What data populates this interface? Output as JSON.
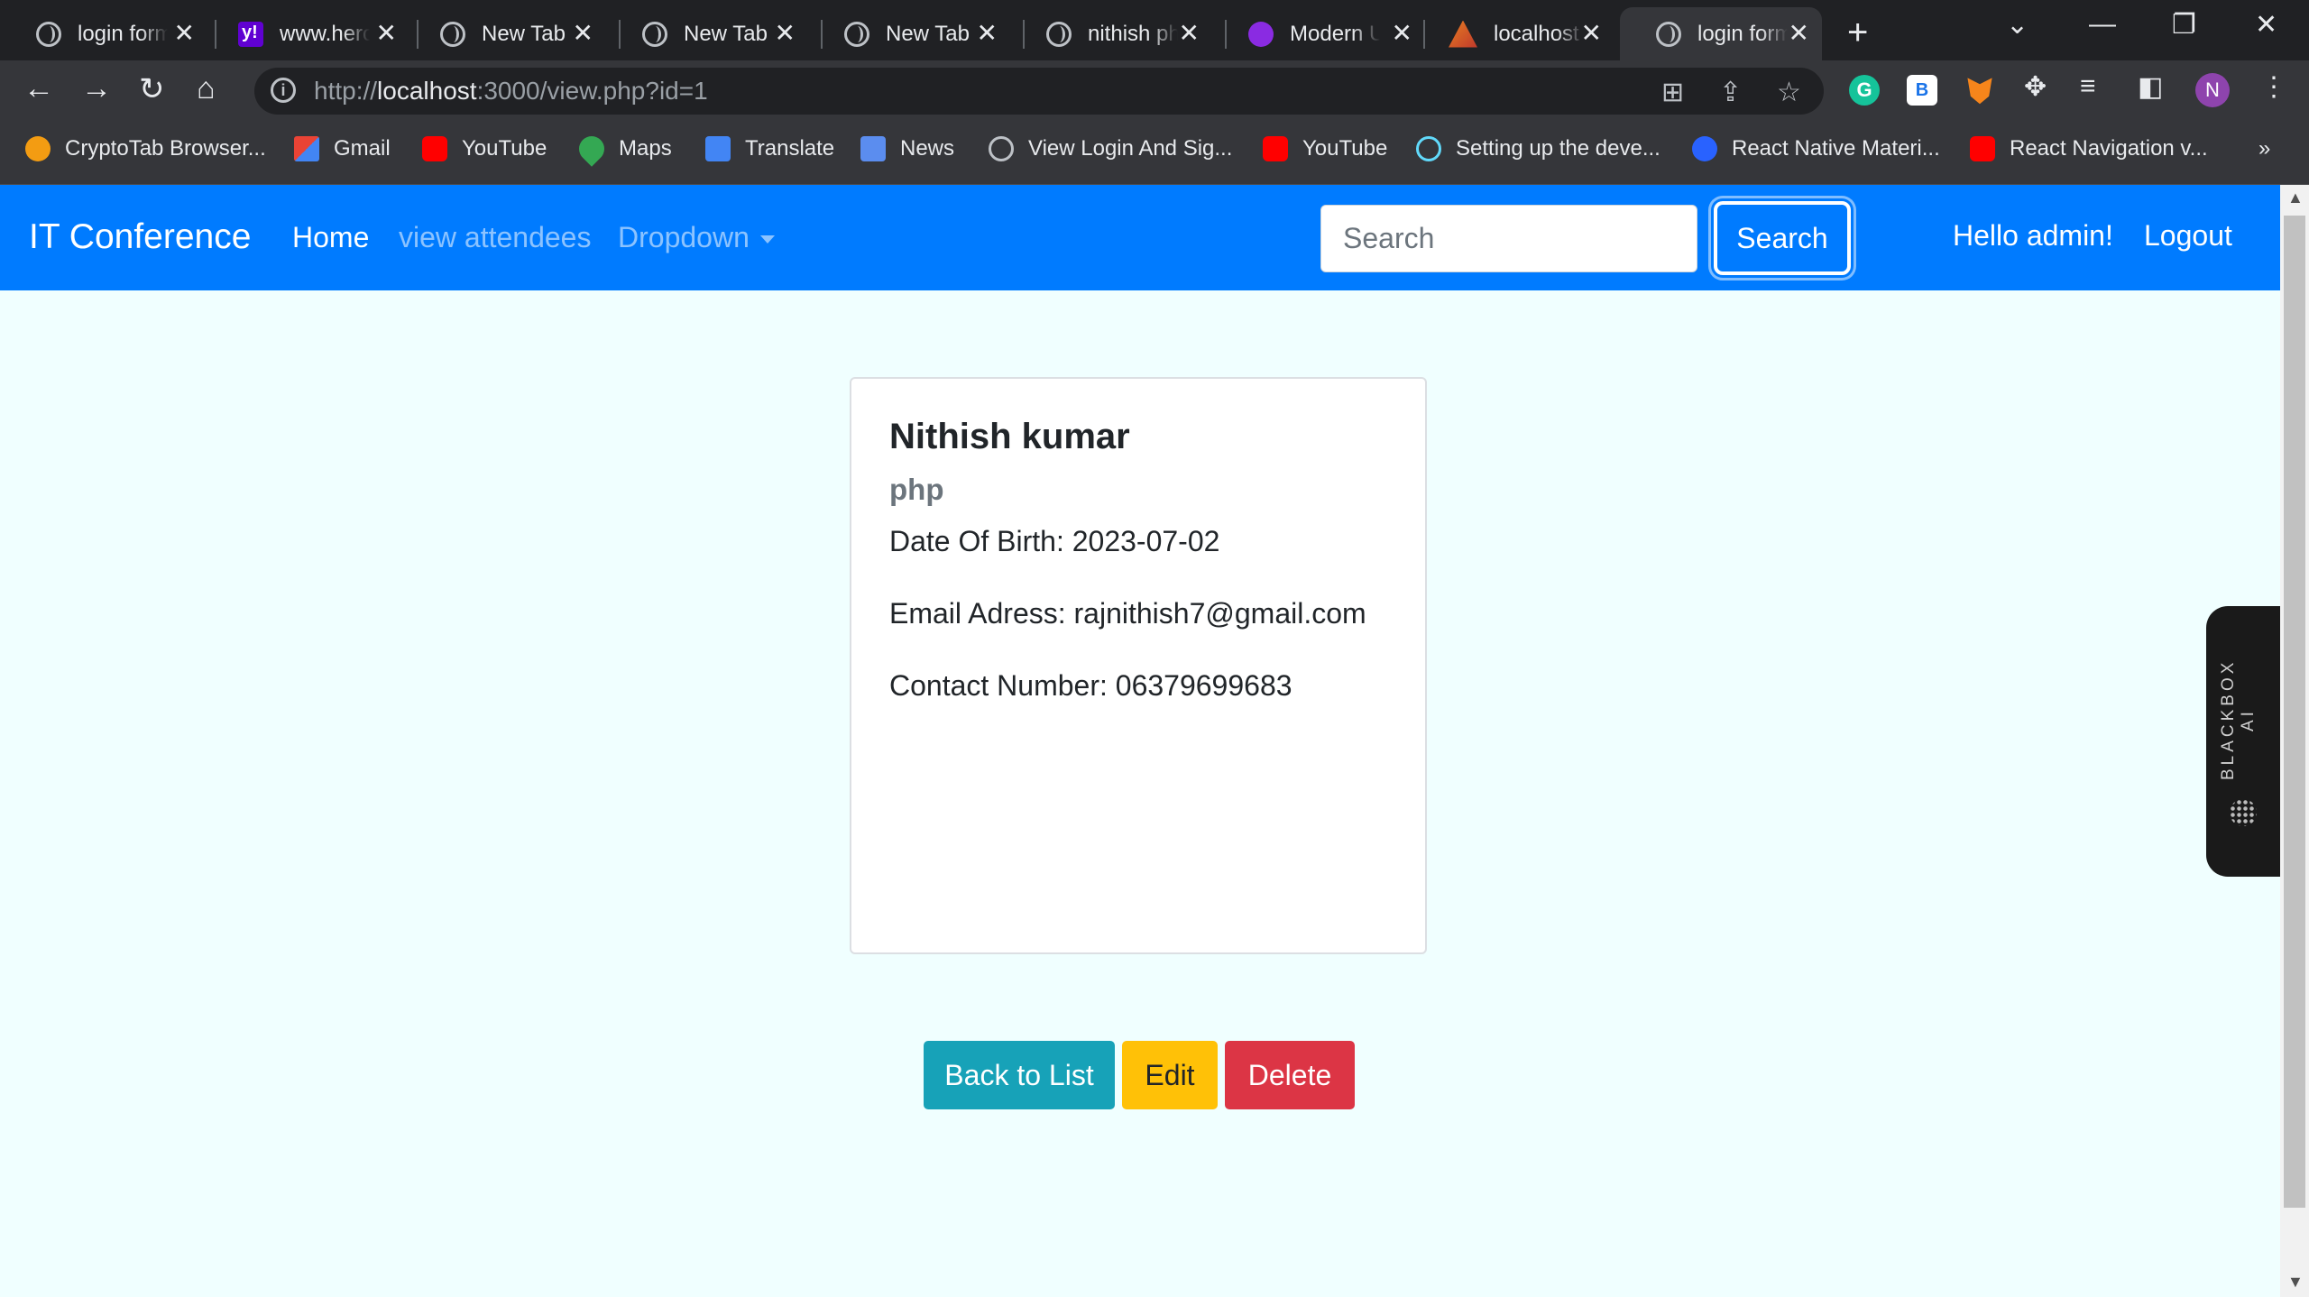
{
  "browser": {
    "tabs": [
      {
        "title": "login form",
        "icon": "globe-icon"
      },
      {
        "title": "www.herokuapp",
        "icon": "yahoo-icon"
      },
      {
        "title": "New Tab",
        "icon": "globe-icon"
      },
      {
        "title": "New Tab",
        "icon": "globe-icon"
      },
      {
        "title": "New Tab",
        "icon": "globe-icon"
      },
      {
        "title": "nithish php",
        "icon": "globe-icon"
      },
      {
        "title": "Modern UI",
        "icon": "modern-icon"
      },
      {
        "title": "localhost",
        "icon": "xampp-icon"
      },
      {
        "title": "login form",
        "icon": "globe-icon"
      }
    ],
    "url_prefix": "http://",
    "url_host": "localhost",
    "url_rest": ":3000/view.php?id=1",
    "profile_initial": "N",
    "grammarly_letter": "G",
    "ext_letter": "B",
    "bookmarks": [
      {
        "label": "CryptoTab Browser...",
        "icon": "cryptotab-icon"
      },
      {
        "label": "Gmail",
        "icon": "gmail-icon"
      },
      {
        "label": "YouTube",
        "icon": "youtube-icon"
      },
      {
        "label": "Maps",
        "icon": "maps-icon"
      },
      {
        "label": "Translate",
        "icon": "translate-icon"
      },
      {
        "label": "News",
        "icon": "news-icon"
      },
      {
        "label": "View Login And Sig...",
        "icon": "globe-icon"
      },
      {
        "label": "YouTube",
        "icon": "youtube-icon"
      },
      {
        "label": "Setting up the deve...",
        "icon": "react-icon"
      },
      {
        "label": "React Native Materi...",
        "icon": "react-native-material-icon"
      },
      {
        "label": "React Navigation v...",
        "icon": "youtube-icon"
      }
    ]
  },
  "navbar": {
    "brand": "IT Conference",
    "links": {
      "home": "Home",
      "attendees": "view attendees",
      "dropdown": "Dropdown"
    },
    "search_placeholder": "Search",
    "search_button": "Search",
    "greeting": "Hello admin!",
    "logout": "Logout"
  },
  "attendee": {
    "name": "Nithish kumar",
    "specialty": "php",
    "dob": "Date Of Birth: 2023-07-02",
    "email": "Email Adress: rajnithish7@gmail.com",
    "contact": "Contact Number: 06379699683"
  },
  "actions": {
    "back": "Back to List",
    "edit": "Edit",
    "delete": "Delete"
  },
  "blackbox_label": "BLACKBOX AI",
  "colors": {
    "navbar": "#007bff",
    "page_bg": "#f0ffff",
    "info": "#17a2b8",
    "warning": "#ffc107",
    "danger": "#dc3545"
  }
}
